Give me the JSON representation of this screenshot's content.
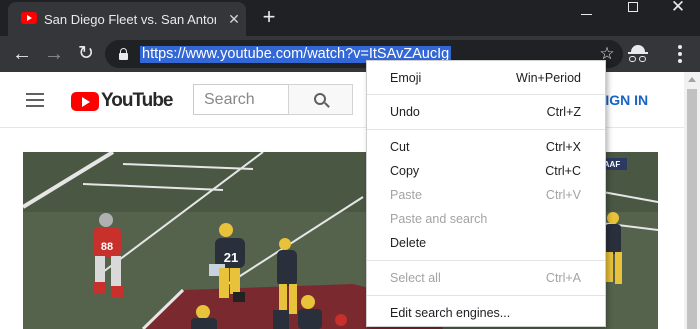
{
  "browser": {
    "tab_title": "San Diego Fleet vs. San Antonio Commanders",
    "tab_close_symbol": "✕",
    "new_tab_symbol": "+",
    "window_close_symbol": "✕",
    "url": "https://www.youtube.com/watch?v=ItSAvZAucIg",
    "icons": {
      "back": "←",
      "forward": "→",
      "reload": "↻",
      "star": "☆"
    }
  },
  "youtube": {
    "logo_text": "YouTube",
    "search_placeholder": "Search",
    "signin_label": "SIGN IN",
    "brand_red": "#ff0000",
    "link_blue": "#1a63c7"
  },
  "video": {
    "player_number_left": "88",
    "player_number_center": "21",
    "scoreboard_text": "AAF"
  },
  "context_menu": {
    "items": [
      {
        "label": "Emoji",
        "shortcut": "Win+Period",
        "disabled": false
      },
      {
        "label": "Undo",
        "shortcut": "Ctrl+Z",
        "disabled": false
      },
      {
        "label": "Cut",
        "shortcut": "Ctrl+X",
        "disabled": false
      },
      {
        "label": "Copy",
        "shortcut": "Ctrl+C",
        "disabled": false
      },
      {
        "label": "Paste",
        "shortcut": "Ctrl+V",
        "disabled": true
      },
      {
        "label": "Paste and search",
        "shortcut": "",
        "disabled": true
      },
      {
        "label": "Delete",
        "shortcut": "",
        "disabled": false
      },
      {
        "label": "Select all",
        "shortcut": "Ctrl+A",
        "disabled": true
      },
      {
        "label": "Edit search engines...",
        "shortcut": "",
        "disabled": false
      }
    ]
  },
  "colors": {
    "browser_frame": "#202124",
    "toolbar": "#35363a",
    "url_selection": "#3367d6",
    "menu_disabled_text": "#a3a3a3"
  }
}
